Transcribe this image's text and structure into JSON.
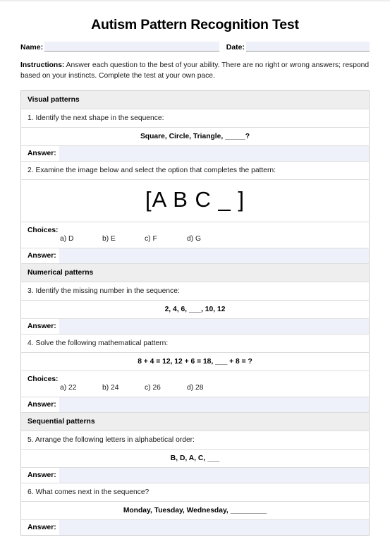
{
  "document": {
    "title": "Autism Pattern Recognition Test",
    "fields": [
      {
        "label": "Name:",
        "value": ""
      },
      {
        "label": "Date:",
        "value": ""
      }
    ],
    "instructions_label": "Instructions:",
    "instructions_text": " Answer each question to the best of your ability. There are no right or wrong answers; respond based on your instincts. Complete the test at your own pace.",
    "answer_label": "Answer:",
    "choices_label": "Choices:",
    "sections": [
      {
        "heading": "Visual patterns",
        "questions": [
          {
            "prompt": "1. Identify the next shape in the sequence:",
            "pattern": "Square, Circle, Triangle, _____?",
            "image": null,
            "choices": [],
            "answer": ""
          },
          {
            "prompt": "2. Examine the image below and select the option that completes the pattern:",
            "pattern": null,
            "image": "[A B C _ ]",
            "choices": [
              "a) D",
              "b) E",
              "c) F",
              "d) G"
            ],
            "answer": ""
          }
        ]
      },
      {
        "heading": "Numerical patterns",
        "questions": [
          {
            "prompt": "3. Identify the missing number in the sequence:",
            "pattern": "2, 4, 6, ___, 10, 12",
            "image": null,
            "choices": [],
            "answer": ""
          },
          {
            "prompt": "4. Solve the following mathematical pattern:",
            "pattern": "8 + 4 = 12, 12 + 6 = 18, ___ + 8 = ?",
            "image": null,
            "choices": [
              "a) 22",
              "b) 24",
              "c) 26",
              "d) 28"
            ],
            "answer": ""
          }
        ]
      },
      {
        "heading": "Sequential patterns",
        "questions": [
          {
            "prompt": "5. Arrange the following letters in alphabetical order:",
            "pattern": "B, D, A, C, ___",
            "image": null,
            "choices": [],
            "answer": ""
          },
          {
            "prompt": "6.  What comes next in the sequence?",
            "pattern": "Monday, Tuesday, Wednesday, _________",
            "image": null,
            "choices": [],
            "answer": ""
          }
        ]
      }
    ],
    "colors": {
      "field_fill": "#eef0fa",
      "section_header_bg": "#eeeeee",
      "border": "#dcdcdc"
    }
  }
}
